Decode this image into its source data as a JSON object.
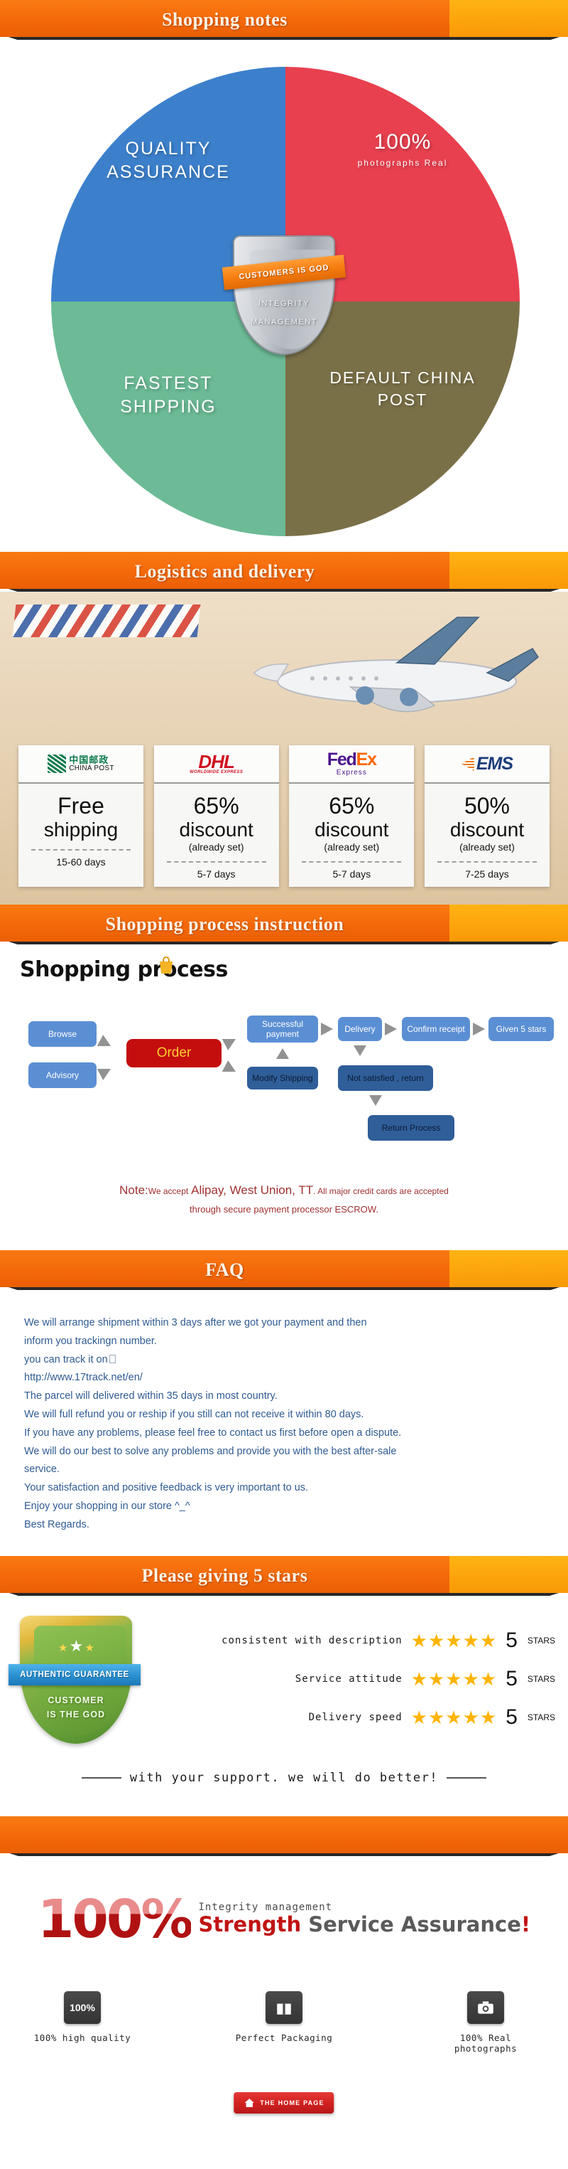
{
  "banners": {
    "shopping_notes": "Shopping notes",
    "logistics": "Logistics and delivery",
    "process": "Shopping process instruction",
    "faq": "FAQ",
    "stars": "Please giving 5 stars"
  },
  "pie": {
    "quadrants": [
      {
        "id": "quality",
        "line1": "QUALITY",
        "line2": "ASSURANCE",
        "color": "#3c80cc"
      },
      {
        "id": "photos",
        "big": "100%",
        "small": "photographs Real",
        "color": "#e8404f"
      },
      {
        "id": "shipping",
        "line1": "FASTEST",
        "line2": "SHIPPING",
        "color": "#6cbb96"
      },
      {
        "id": "post",
        "line1": "DEFAULT  CHINA",
        "line2": "POST",
        "color": "#7a7048"
      }
    ],
    "shield": {
      "ribbon": "CUSTOMERS  IS  GOD",
      "line1": "INTEGRITY",
      "line2": "MANAGEMENT"
    }
  },
  "logistics": {
    "cards": [
      {
        "carrier": "china-post",
        "logo_cn": "中国邮政",
        "logo_en": "CHINA POST",
        "big": "Free",
        "mid": "shipping",
        "sub": "",
        "days": "15-60 days"
      },
      {
        "carrier": "dhl",
        "logo_main": "DHL",
        "logo_sub": "WORLDWIDE EXPRESS",
        "big": "65%",
        "mid": "discount",
        "sub": "(already set)",
        "days": "5-7 days"
      },
      {
        "carrier": "fedex",
        "logo_fed": "Fed",
        "logo_ex": "Ex",
        "logo_sub": "Express",
        "big": "65%",
        "mid": "discount",
        "sub": "(already set)",
        "days": "5-7 days"
      },
      {
        "carrier": "ems",
        "logo_main": "EMS",
        "big": "50%",
        "mid": "discount",
        "sub": "(already set)",
        "days": "7-25 days"
      }
    ]
  },
  "flow": {
    "title": "Shopping process",
    "nodes": {
      "browse": "Browse",
      "advisory": "Advisory",
      "order": "Order",
      "successful_payment": "Successful payment",
      "modify_shipping": "Modify Shipping",
      "delivery": "Delivery",
      "confirm_receipt": "Confirm receipt",
      "given_5_stars": "Given 5 stars",
      "not_satisfied": "Not satisfied , return",
      "return_process": "Return Process"
    },
    "note": {
      "prefix": "Note:",
      "we_accept": "We accept",
      "methods": "Alipay, West Union, TT",
      "tail": ". All major credit cards are accepted",
      "line2": "through secure payment processor ESCROW."
    }
  },
  "faq": {
    "lines": [
      "We will arrange shipment within 3 days after we got your payment and then",
      "inform you trackingn number.",
      "you can track it on",
      "http://www.17track.net/en/",
      "The parcel will delivered within 35 days in most country.",
      "We will full refund you or reship if you still can not receive it within 80 days.",
      "If you have any problems, please feel free to contact us first before open a dispute.",
      "We will do our best to solve any problems and provide you with the best after-sale",
      "service.",
      "Your satisfaction and positive feedback is very important to us.",
      "Enjoy your shopping in our store ^_^",
      "Best Regards."
    ]
  },
  "stars_section": {
    "badge": {
      "ribbon": "AUTHENTIC GUARANTEE",
      "line1": "CUSTOMER",
      "line2": "IS THE GOD"
    },
    "ratings": [
      {
        "label": "consistent with description",
        "stars": "★★★★★",
        "score": "5",
        "unit": "STARS"
      },
      {
        "label": "Service attitude",
        "stars": "★★★★★",
        "score": "5",
        "unit": "STARS"
      },
      {
        "label": "Delivery speed",
        "stars": "★★★★★",
        "score": "5",
        "unit": "STARS"
      }
    ],
    "support": "with your support. we will do better!"
  },
  "footer": {
    "percent": "100",
    "percent_symbol": "%",
    "integrity": "Integrity management",
    "strength": "Strength",
    "service": "Service Assurance",
    "exclaim": "!",
    "icons": [
      {
        "id": "quality",
        "badge": "100%",
        "label": "100% high quality"
      },
      {
        "id": "packaging",
        "badge": "",
        "label": "Perfect Packaging"
      },
      {
        "id": "photos",
        "badge": "",
        "label": "100% Real photographs"
      }
    ],
    "home_button": "THE HOME PAGE"
  },
  "colors": {
    "orange": "#f4690a",
    "amber": "#fca30b",
    "blue": "#3c80cc",
    "red": "#e8404f",
    "green": "#6cbb96",
    "brown": "#7a7048",
    "faq_text": "#2f5b92",
    "note_red": "#a03030"
  }
}
